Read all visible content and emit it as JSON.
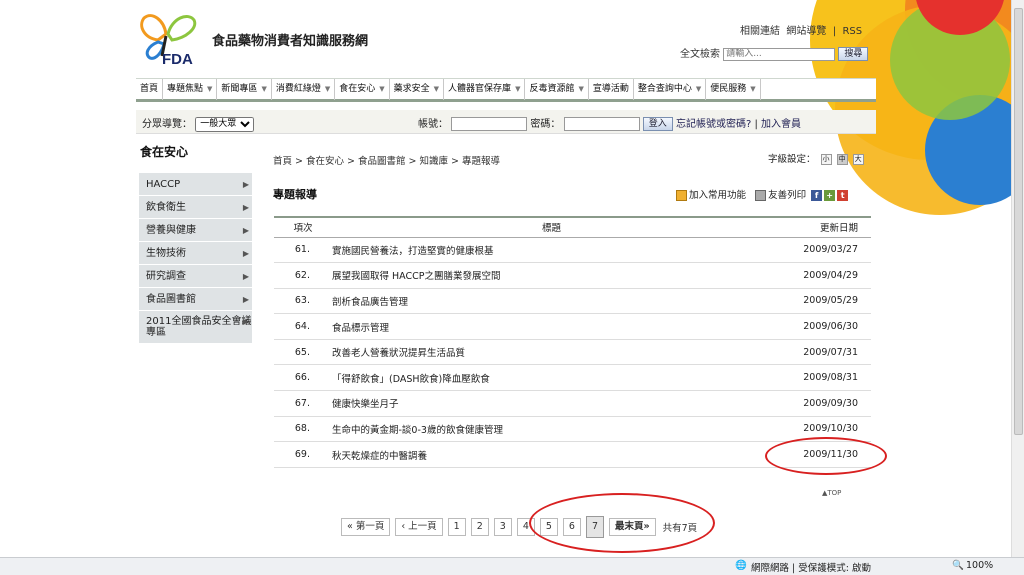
{
  "header": {
    "site_name": "食品藥物消費者知識服務網",
    "logo_text": "FDA",
    "related_links": "相關連結",
    "sitemap": "網站導覽",
    "rss": "RSS",
    "search_label": "全文檢索",
    "search_placeholder": "請輸入...",
    "search_button": "搜尋"
  },
  "nav": {
    "items": [
      "首頁",
      "專題焦點",
      "新聞專區",
      "消費紅綠燈",
      "食在安心",
      "藥求安全",
      "人體器官保存庫",
      "反毒資源館",
      "宣導活動",
      "整合查詢中心",
      "便民服務"
    ]
  },
  "bar2": {
    "category_label": "分眾導覽：",
    "category_value": "一般大眾",
    "account_label": "帳號：",
    "password_label": "密碼：",
    "login_button": "登入",
    "forgot_link": "忘記帳號或密碼?",
    "separator": "|",
    "join_link": "加入會員"
  },
  "sidebar": {
    "heading": "食在安心",
    "items": [
      "HACCP",
      "飲食衛生",
      "營養與健康",
      "生物技術",
      "研究調查",
      "食品圖書館",
      "2011全國食品安全會議專區"
    ]
  },
  "breadcrumb": "首頁 > 食在安心 > 食品圖書館 > 知識庫 > 專題報導",
  "font_setting": {
    "label": "字級設定：",
    "small": "小",
    "medium": "中",
    "large": "大"
  },
  "page_title": "專題報導",
  "tools": {
    "favorite": "加入常用功能",
    "print": "友善列印"
  },
  "table": {
    "headers": {
      "no": "項次",
      "title": "標題",
      "date": "更新日期"
    },
    "rows": [
      {
        "no": "61.",
        "title": "實施國民營養法，打造堅實的健康根基",
        "date": "2009/03/27"
      },
      {
        "no": "62.",
        "title": "展望我國取得 HACCP之團膳業發展空間",
        "date": "2009/04/29"
      },
      {
        "no": "63.",
        "title": "剖析食品廣告管理",
        "date": "2009/05/29"
      },
      {
        "no": "64.",
        "title": "食品標示管理",
        "date": "2009/06/30"
      },
      {
        "no": "65.",
        "title": "改善老人營養狀況提昇生活品質",
        "date": "2009/07/31"
      },
      {
        "no": "66.",
        "title": "「得舒飲食」(DASH飲食)降血壓飲食",
        "date": "2009/08/31"
      },
      {
        "no": "67.",
        "title": "健康快樂坐月子",
        "date": "2009/09/30"
      },
      {
        "no": "68.",
        "title": "生命中的黃金期-談0-3歲的飲食健康管理",
        "date": "2009/10/30"
      },
      {
        "no": "69.",
        "title": "秋天乾燥症的中醫調養",
        "date": "2009/11/30"
      }
    ]
  },
  "top_link": "▲TOP",
  "pager": {
    "first": "« 第一頁",
    "prev": "‹ 上一頁",
    "pages": [
      "1",
      "2",
      "3",
      "4",
      "5",
      "6",
      "7"
    ],
    "current": "7",
    "last": "最末頁»",
    "total": "共有7頁"
  },
  "statusbar": {
    "zone": "網際網路 | 受保護模式: 啟動",
    "zoom": "100%"
  },
  "colors": {
    "accent_red": "#d82020",
    "nav_border": "#8fa08f",
    "sidebar_bg": "#dfe3e5"
  }
}
